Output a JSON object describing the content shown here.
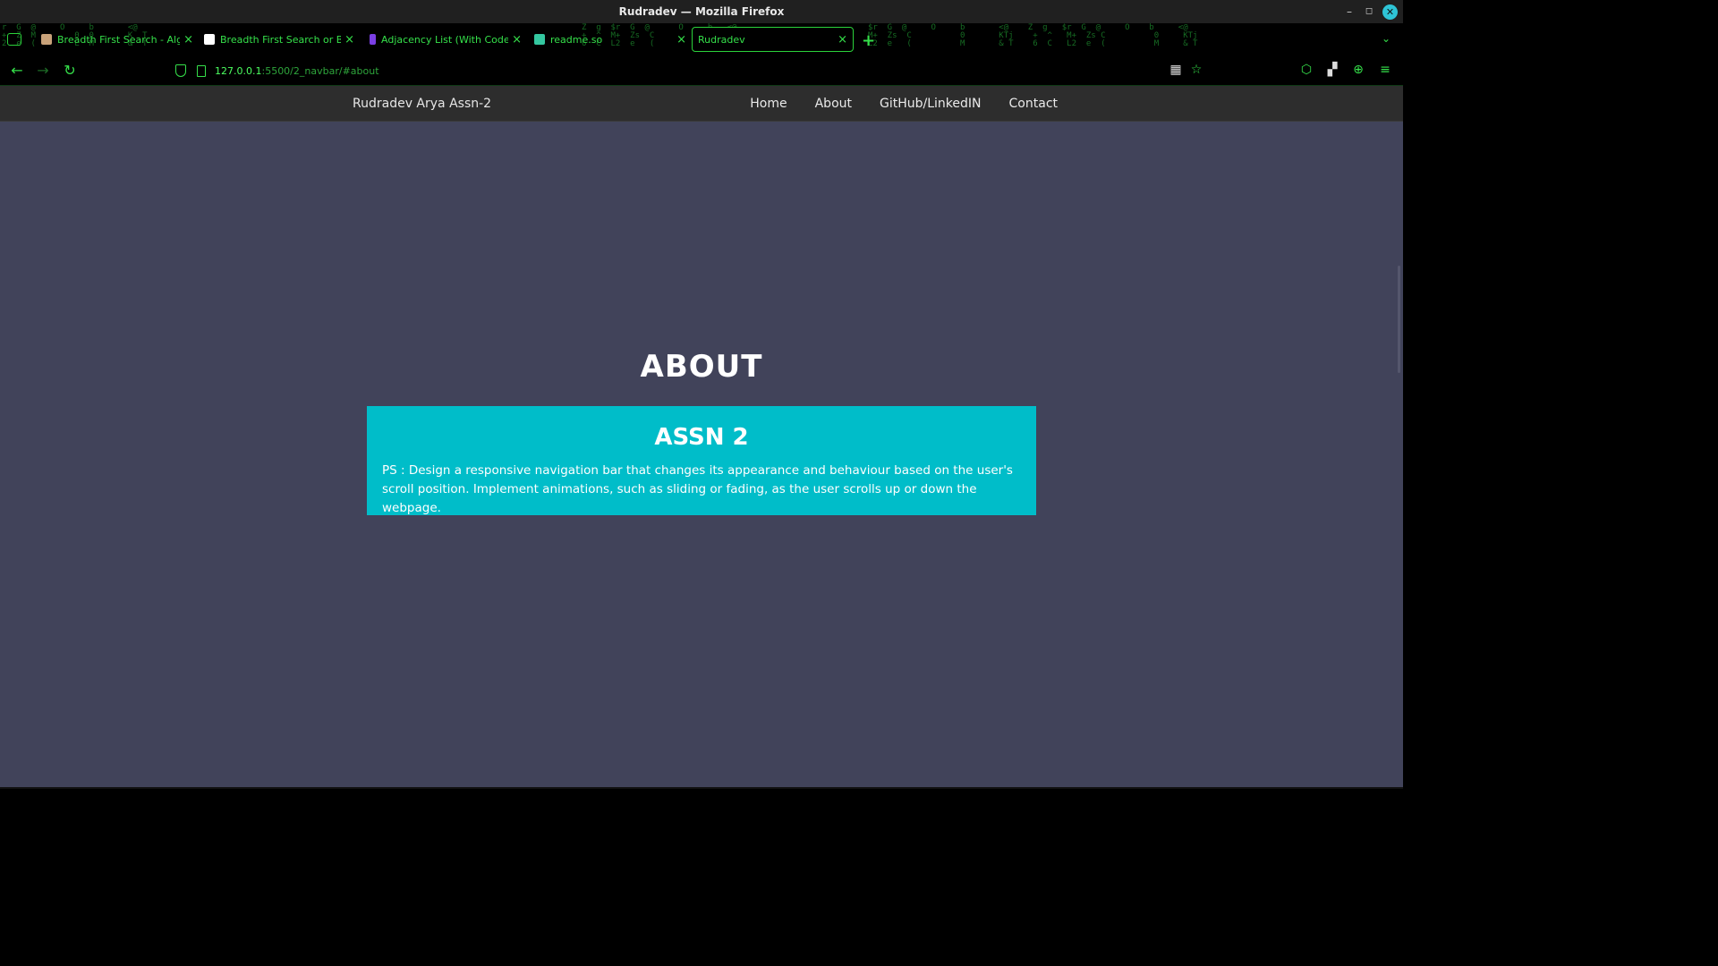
{
  "window": {
    "title": "Rudradev — Mozilla Firefox"
  },
  "tabs": [
    {
      "label": "Breadth First Search - Algo",
      "favicon_color": "#c9a27a"
    },
    {
      "label": "Breadth First Search or BFS",
      "favicon_color": "#ffffff"
    },
    {
      "label": "Adjacency List (With Code in",
      "favicon_color": "#7b3fe4"
    },
    {
      "label": "readme.so",
      "favicon_color": "#34c7a0"
    },
    {
      "label": "Rudradev",
      "favicon_color": ""
    }
  ],
  "toolbar": {
    "url_host": "127.0.0.1",
    "url_rest": ":5500/2_navbar/#about"
  },
  "site": {
    "brand": "Rudradev Arya Assn-2",
    "nav": [
      "Home",
      "About",
      "GitHub/LinkedIN",
      "Contact"
    ],
    "section_title": "ABOUT",
    "card_title": "ASSN 2",
    "card_text": "PS : Design a responsive navigation bar that changes its appearance and behaviour based on the user's scroll position. Implement animations, such as sliding or fading, as the user scrolls up or down the webpage."
  },
  "colors": {
    "page_bg": "#41435a",
    "card_bg": "#00bdc9",
    "site_nav_bg": "#2d2d2d",
    "browser_accent": "#35e04a"
  }
}
